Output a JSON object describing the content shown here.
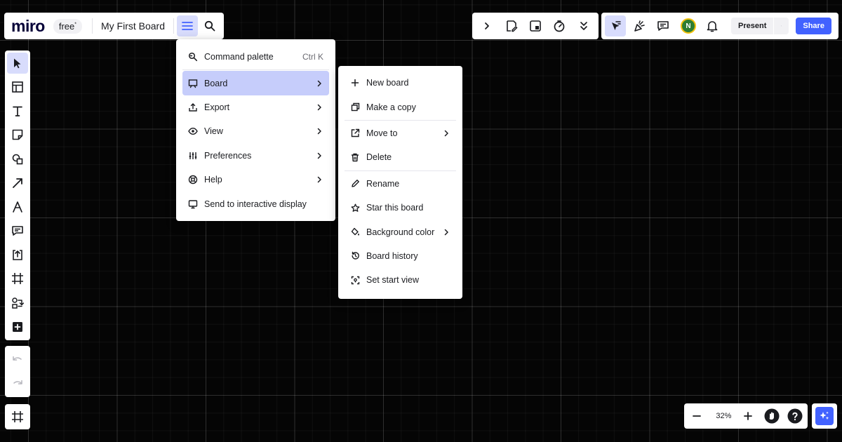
{
  "app": {
    "logo": "miro",
    "plan": "free",
    "plan_mark": "*",
    "board_title": "My First Board"
  },
  "topbar": {
    "present_label": "Present",
    "share_label": "Share",
    "avatar_initial": "N",
    "avatar_color": "#2e7d32",
    "accent": "#4262ff"
  },
  "zoom": {
    "level": "32%"
  },
  "main_menu": {
    "items": [
      {
        "label": "Command palette",
        "shortcut": "Ctrl K",
        "icon": "command-palette-icon"
      },
      {
        "label": "Board",
        "icon": "board-icon"
      },
      {
        "label": "Export",
        "icon": "export-icon"
      },
      {
        "label": "View",
        "icon": "eye-icon"
      },
      {
        "label": "Preferences",
        "icon": "preferences-icon"
      },
      {
        "label": "Help",
        "icon": "help-icon"
      },
      {
        "label": "Send to interactive display",
        "icon": "display-icon"
      }
    ]
  },
  "board_menu": {
    "items": [
      {
        "label": "New board",
        "icon": "plus-icon"
      },
      {
        "label": "Make a copy",
        "icon": "copy-icon"
      },
      {
        "label": "Move to",
        "icon": "move-icon"
      },
      {
        "label": "Delete",
        "icon": "trash-icon"
      },
      {
        "label": "Rename",
        "icon": "pencil-icon"
      },
      {
        "label": "Star this board",
        "icon": "star-icon"
      },
      {
        "label": "Background color",
        "icon": "paint-bucket-icon"
      },
      {
        "label": "Board history",
        "icon": "history-icon"
      },
      {
        "label": "Set start view",
        "icon": "start-view-icon"
      }
    ]
  }
}
